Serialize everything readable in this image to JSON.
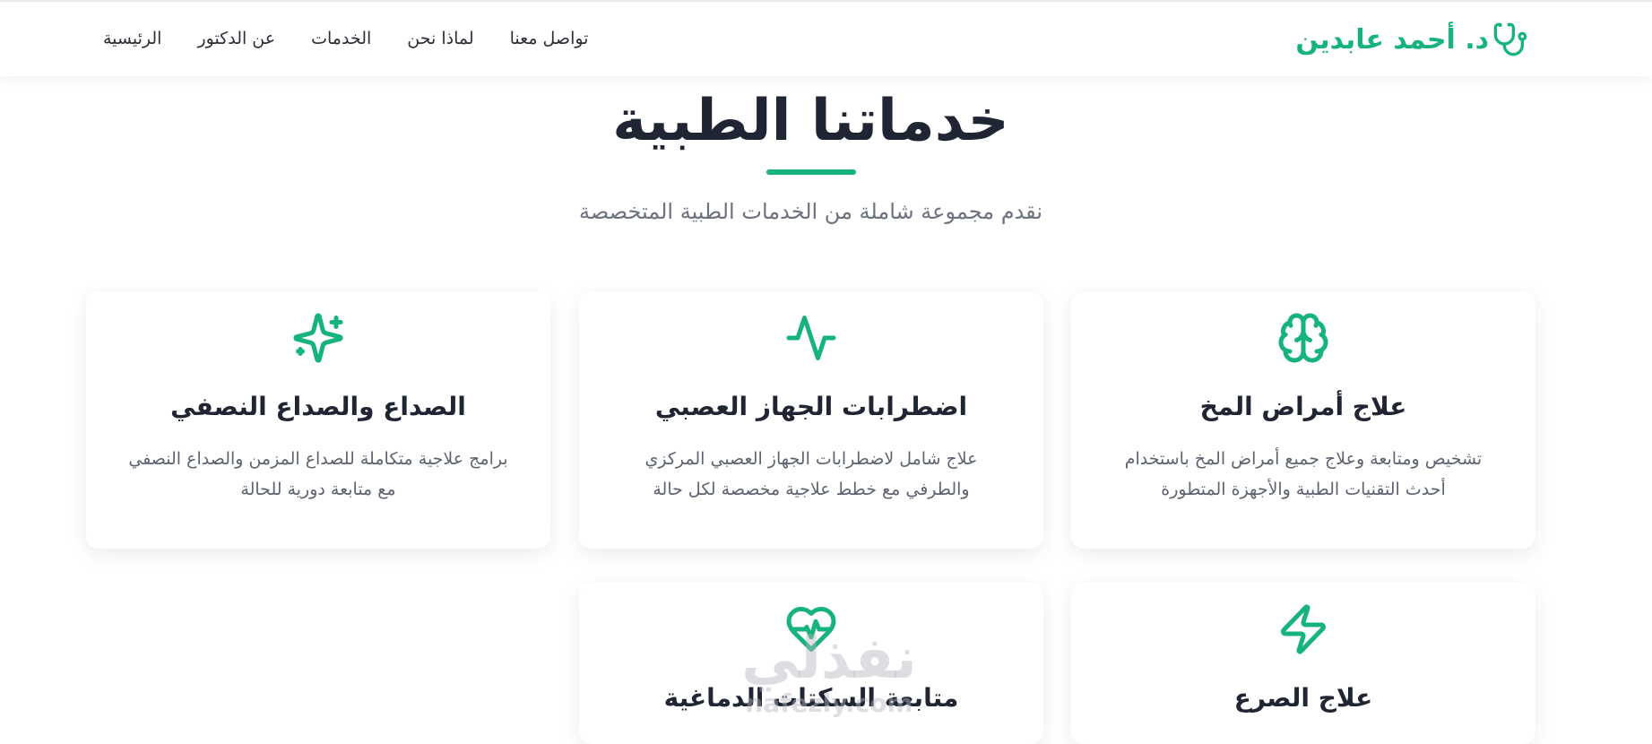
{
  "brand": {
    "name": "د. أحمد عابدين",
    "icon": "stethoscope-icon",
    "color": "#17b37c"
  },
  "nav": {
    "items": [
      "الرئيسية",
      "عن الدكتور",
      "الخدمات",
      "لماذا نحن",
      "تواصل معنا"
    ]
  },
  "section": {
    "title": "خدماتنا الطبية",
    "subtitle": "نقدم مجموعة شاملة من الخدمات الطبية المتخصصة"
  },
  "services": [
    {
      "icon": "brain-icon",
      "title": "علاج أمراض المخ",
      "description": "تشخيص ومتابعة وعلاج جميع أمراض المخ باستخدام أحدث التقنيات الطبية والأجهزة المتطورة"
    },
    {
      "icon": "activity-icon",
      "title": "اضطرابات الجهاز العصبي",
      "description": "علاج شامل لاضطرابات الجهاز العصبي المركزي والطرفي مع خطط علاجية مخصصة لكل حالة"
    },
    {
      "icon": "sparkles-icon",
      "title": "الصداع والصداع النصفي",
      "description": "برامج علاجية متكاملة للصداع المزمن والصداع النصفي مع متابعة دورية للحالة"
    },
    {
      "icon": "lightning-icon",
      "title": "علاج الصرع",
      "description": ""
    },
    {
      "icon": "heart-pulse-icon",
      "title": "متابعة السكتات الدماغية",
      "description": ""
    }
  ],
  "watermark": {
    "arabic": "نفذلي",
    "latin": "nafezly.com"
  }
}
